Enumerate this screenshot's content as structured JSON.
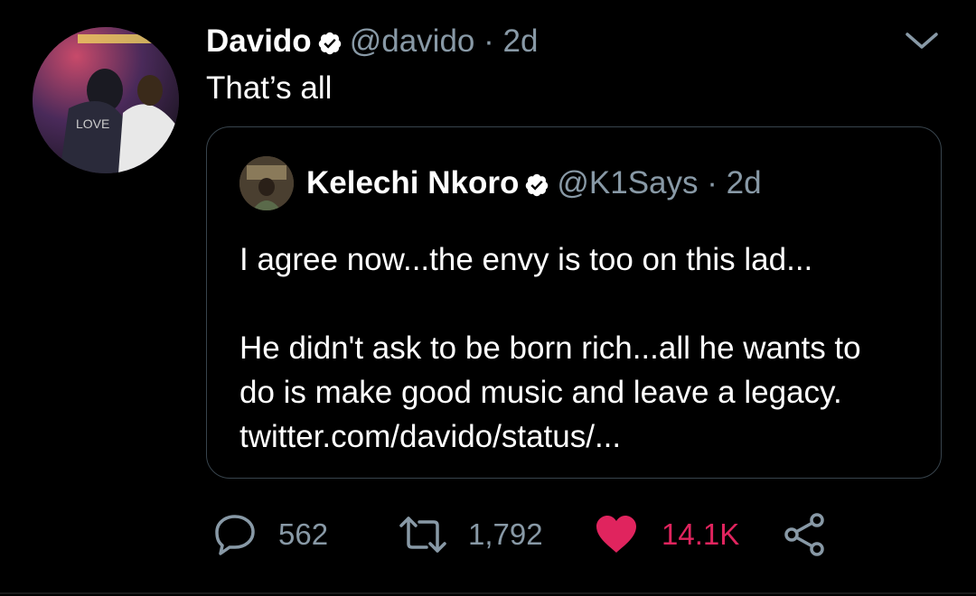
{
  "tweet": {
    "author_name": "Davido",
    "author_handle": "@davido",
    "separator": "·",
    "time": "2d",
    "text": "That’s all"
  },
  "quote": {
    "author_name": "Kelechi Nkoro",
    "author_handle": "@K1Says",
    "separator": "·",
    "time": "2d",
    "lines": [
      "I agree now...the envy is too on this lad...",
      "He didn't ask to be born rich...all he wants to",
      "do is make good music and leave a legacy.",
      "twitter.com/davido/status/..."
    ]
  },
  "actions": {
    "replies": "562",
    "retweets": "1,792",
    "likes": "14.1K"
  },
  "colors": {
    "background": "#000000",
    "secondary_text": "#8899a6",
    "like": "#e0245e",
    "border": "#38444d"
  },
  "icons": [
    "verified-badge-icon",
    "chevron-down-icon",
    "reply-icon",
    "retweet-icon",
    "heart-icon",
    "share-icon"
  ]
}
